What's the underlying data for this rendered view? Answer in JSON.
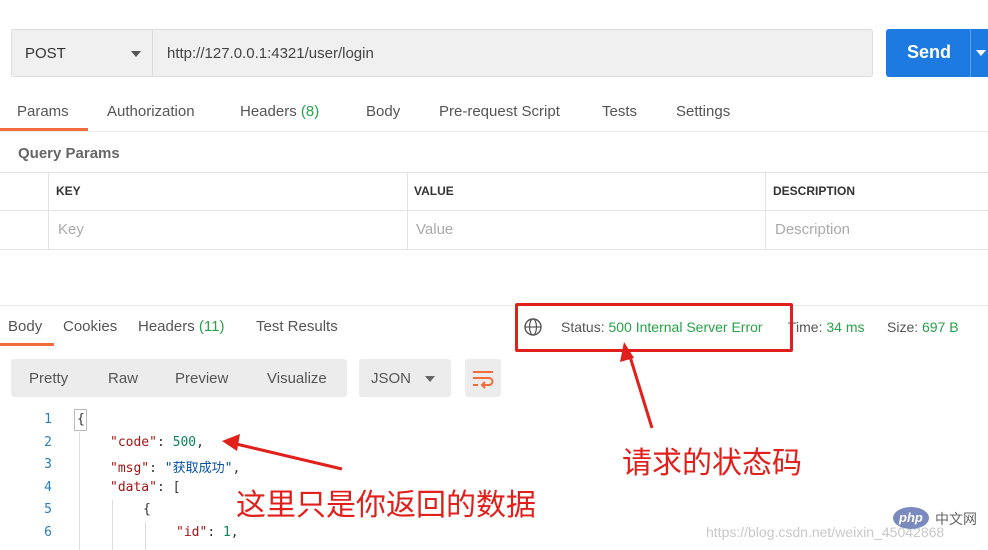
{
  "request": {
    "method": "POST",
    "url": "http://127.0.0.1:4321/user/login",
    "send_label": "Send"
  },
  "tabs": [
    {
      "label": "Params"
    },
    {
      "label": "Authorization"
    },
    {
      "label": "Headers",
      "count": "(8)"
    },
    {
      "label": "Body"
    },
    {
      "label": "Pre-request Script"
    },
    {
      "label": "Tests"
    },
    {
      "label": "Settings"
    }
  ],
  "query_params": {
    "title": "Query Params",
    "columns": [
      "KEY",
      "VALUE",
      "DESCRIPTION"
    ],
    "placeholders": {
      "key": "Key",
      "value": "Value",
      "description": "Description"
    }
  },
  "response": {
    "tabs": [
      {
        "label": "Body"
      },
      {
        "label": "Cookies"
      },
      {
        "label": "Headers",
        "count": "(11)"
      },
      {
        "label": "Test Results"
      }
    ],
    "status_label": "Status:",
    "status_value": "500 Internal Server Error",
    "time_label": "Time:",
    "time_value": "34 ms",
    "size_label": "Size:",
    "size_value": "697 B"
  },
  "view": {
    "options": [
      "Pretty",
      "Raw",
      "Preview",
      "Visualize"
    ],
    "format": "JSON"
  },
  "code": {
    "line_numbers": [
      "1",
      "2",
      "3",
      "4",
      "5",
      "6"
    ],
    "brace_open": "{",
    "key_code": "\"code\"",
    "val_code": "500",
    "key_msg": "\"msg\"",
    "val_msg": "\"获取成功\"",
    "key_data": "\"data\"",
    "bracket_open": "[",
    "key_id": "\"id\"",
    "val_id": "1"
  },
  "annotations": {
    "status_note": "请求的状态码",
    "data_note": "这里只是你返回的数据"
  },
  "watermark": {
    "blog": "https://blog.csdn.net/weixin_45042868",
    "logo": "php",
    "logo_text": "中文网"
  },
  "colors": {
    "accent_orange": "#f26b3a",
    "send_blue": "#1d7ae0",
    "status_green": "#26a24a",
    "annotation_red": "#e1201c"
  }
}
